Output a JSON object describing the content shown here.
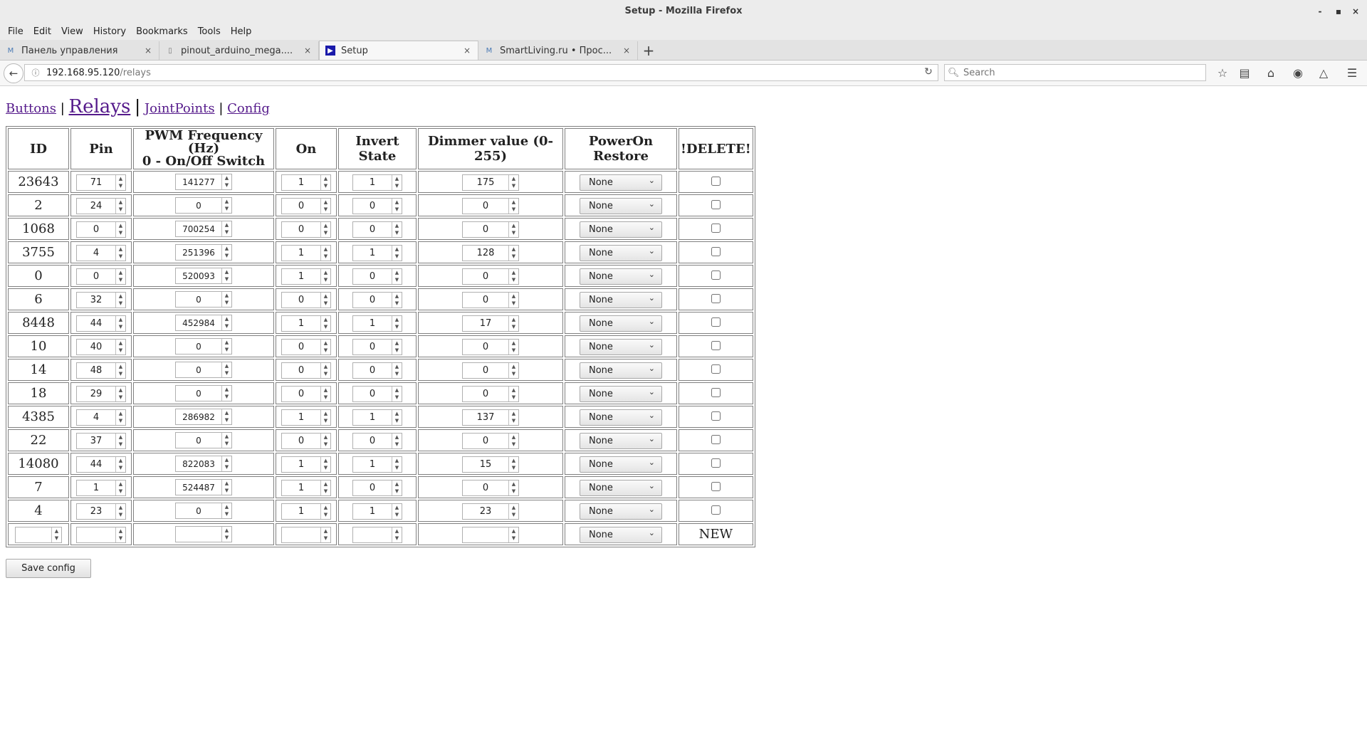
{
  "window": {
    "title": "Setup - Mozilla Firefox",
    "controls": [
      "-",
      "▪",
      "×"
    ]
  },
  "menu": [
    "File",
    "Edit",
    "View",
    "History",
    "Bookmarks",
    "Tools",
    "Help"
  ],
  "tabs": [
    {
      "title": "Панель управления",
      "icon": "M",
      "close": "×"
    },
    {
      "title": "pinout_arduino_mega....",
      "icon": "▯",
      "close": "×"
    },
    {
      "title": "Setup",
      "icon": "▶",
      "close": "×"
    },
    {
      "title": "SmartLiving.ru • Прос...",
      "icon": "M",
      "close": "×"
    }
  ],
  "new_tab": "+",
  "address": {
    "host": "192.168.95.120",
    "path": "/relays"
  },
  "search": {
    "placeholder": "Search"
  },
  "page": {
    "nav": [
      "Buttons",
      "Relays",
      "JointPoints",
      "Config"
    ],
    "separator": "|",
    "headers": [
      "ID",
      "Pin",
      "PWM Frequency (Hz)",
      "0 - On/Off Switch",
      "On",
      "Invert State",
      "Dimmer value (0-255)",
      "PowerOn Restore",
      "!DELETE!"
    ],
    "rows": [
      {
        "id": "23643",
        "pin": "71",
        "pwm": "141277",
        "on": "1",
        "inv": "1",
        "dim": "175",
        "restore": "None"
      },
      {
        "id": "2",
        "pin": "24",
        "pwm": "0",
        "on": "0",
        "inv": "0",
        "dim": "0",
        "restore": "None"
      },
      {
        "id": "1068",
        "pin": "0",
        "pwm": "700254",
        "on": "0",
        "inv": "0",
        "dim": "0",
        "restore": "None"
      },
      {
        "id": "3755",
        "pin": "4",
        "pwm": "251396",
        "on": "1",
        "inv": "1",
        "dim": "128",
        "restore": "None"
      },
      {
        "id": "0",
        "pin": "0",
        "pwm": "520093",
        "on": "1",
        "inv": "0",
        "dim": "0",
        "restore": "None"
      },
      {
        "id": "6",
        "pin": "32",
        "pwm": "0",
        "on": "0",
        "inv": "0",
        "dim": "0",
        "restore": "None"
      },
      {
        "id": "8448",
        "pin": "44",
        "pwm": "452984",
        "on": "1",
        "inv": "1",
        "dim": "17",
        "restore": "None"
      },
      {
        "id": "10",
        "pin": "40",
        "pwm": "0",
        "on": "0",
        "inv": "0",
        "dim": "0",
        "restore": "None"
      },
      {
        "id": "14",
        "pin": "48",
        "pwm": "0",
        "on": "0",
        "inv": "0",
        "dim": "0",
        "restore": "None"
      },
      {
        "id": "18",
        "pin": "29",
        "pwm": "0",
        "on": "0",
        "inv": "0",
        "dim": "0",
        "restore": "None"
      },
      {
        "id": "4385",
        "pin": "4",
        "pwm": "286982",
        "on": "1",
        "inv": "1",
        "dim": "137",
        "restore": "None"
      },
      {
        "id": "22",
        "pin": "37",
        "pwm": "0",
        "on": "0",
        "inv": "0",
        "dim": "0",
        "restore": "None"
      },
      {
        "id": "14080",
        "pin": "44",
        "pwm": "822083",
        "on": "1",
        "inv": "1",
        "dim": "15",
        "restore": "None"
      },
      {
        "id": "7",
        "pin": "1",
        "pwm": "524487",
        "on": "1",
        "inv": "0",
        "dim": "0",
        "restore": "None"
      },
      {
        "id": "4",
        "pin": "23",
        "pwm": "0",
        "on": "1",
        "inv": "1",
        "dim": "23",
        "restore": "None"
      }
    ],
    "new_row": {
      "restore": "None",
      "label": "NEW"
    },
    "save_label": "Save config"
  }
}
